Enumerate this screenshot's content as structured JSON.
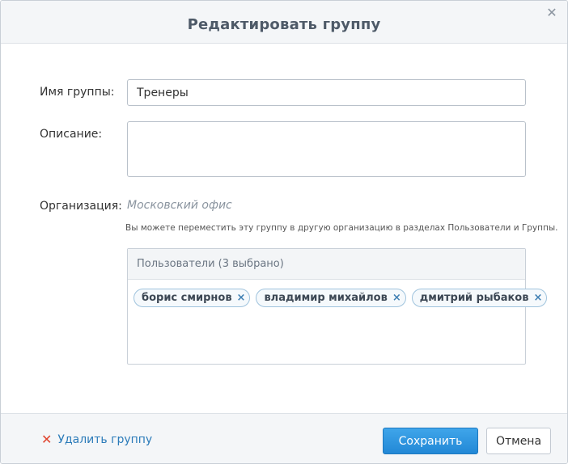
{
  "dialog": {
    "title": "Редактировать группу",
    "close_icon": "close-icon",
    "close_glyph": "✕"
  },
  "form": {
    "name_label": "Имя группы:",
    "name_value": "Тренеры",
    "description_label": "Описание:",
    "description_value": "",
    "organization_label": "Организация:",
    "organization_value": "Московский офис",
    "hint": "Вы можете переместить эту группу в другую организацию в разделах Пользователи и Группы."
  },
  "users": {
    "header": "Пользователи (3 выбрано)",
    "remove_glyph": "×",
    "selected": [
      {
        "name": "борис смирнов"
      },
      {
        "name": "владимир михайлов"
      },
      {
        "name": "дмитрий рыбаков"
      }
    ]
  },
  "footer": {
    "delete_label": "Удалить группу",
    "delete_glyph": "✕",
    "save_label": "Сохранить",
    "cancel_label": "Отмена"
  },
  "colors": {
    "accent": "#2288d6",
    "link": "#2b7bb9",
    "danger": "#e0442e"
  }
}
